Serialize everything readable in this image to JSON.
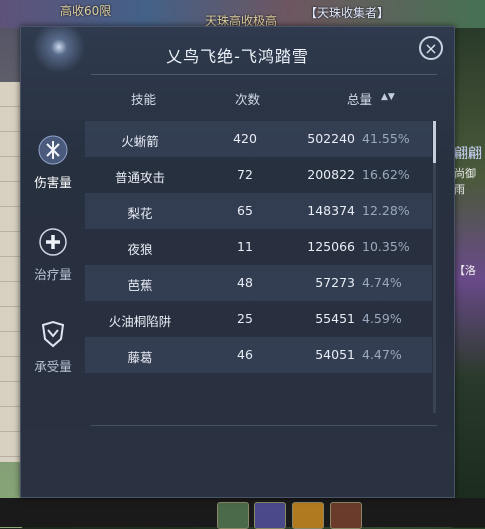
{
  "background": {
    "top_texts": [
      "高收60限",
      "天珠高收极高",
      "【天珠收集者】"
    ],
    "right_texts": [
      "翩翩",
      "尚御雨",
      "【洛"
    ]
  },
  "panel": {
    "title": "乂鸟飞绝-飞鸿踏雪",
    "close_label": "×",
    "tabs": [
      {
        "label": "伤害量",
        "icon": "sword-shield-icon",
        "active": true
      },
      {
        "label": "治疗量",
        "icon": "heal-cross-icon",
        "active": false
      },
      {
        "label": "承受量",
        "icon": "armor-icon",
        "active": false
      }
    ],
    "table": {
      "headers": {
        "skill": "技能",
        "count": "次数",
        "total": "总量"
      },
      "sort_icon": "▲▼",
      "rows": [
        {
          "skill": "火蜥箭",
          "count": "420",
          "total": "502240",
          "pct": "41.55%"
        },
        {
          "skill": "普通攻击",
          "count": "72",
          "total": "200822",
          "pct": "16.62%"
        },
        {
          "skill": "梨花",
          "count": "65",
          "total": "148374",
          "pct": "12.28%"
        },
        {
          "skill": "夜狼",
          "count": "11",
          "total": "125066",
          "pct": "10.35%"
        },
        {
          "skill": "芭蕉",
          "count": "48",
          "total": "57273",
          "pct": "4.74%"
        },
        {
          "skill": "火油桐陷阱",
          "count": "25",
          "total": "55451",
          "pct": "4.59%"
        },
        {
          "skill": "藤葛",
          "count": "46",
          "total": "54051",
          "pct": "4.47%"
        }
      ]
    }
  }
}
